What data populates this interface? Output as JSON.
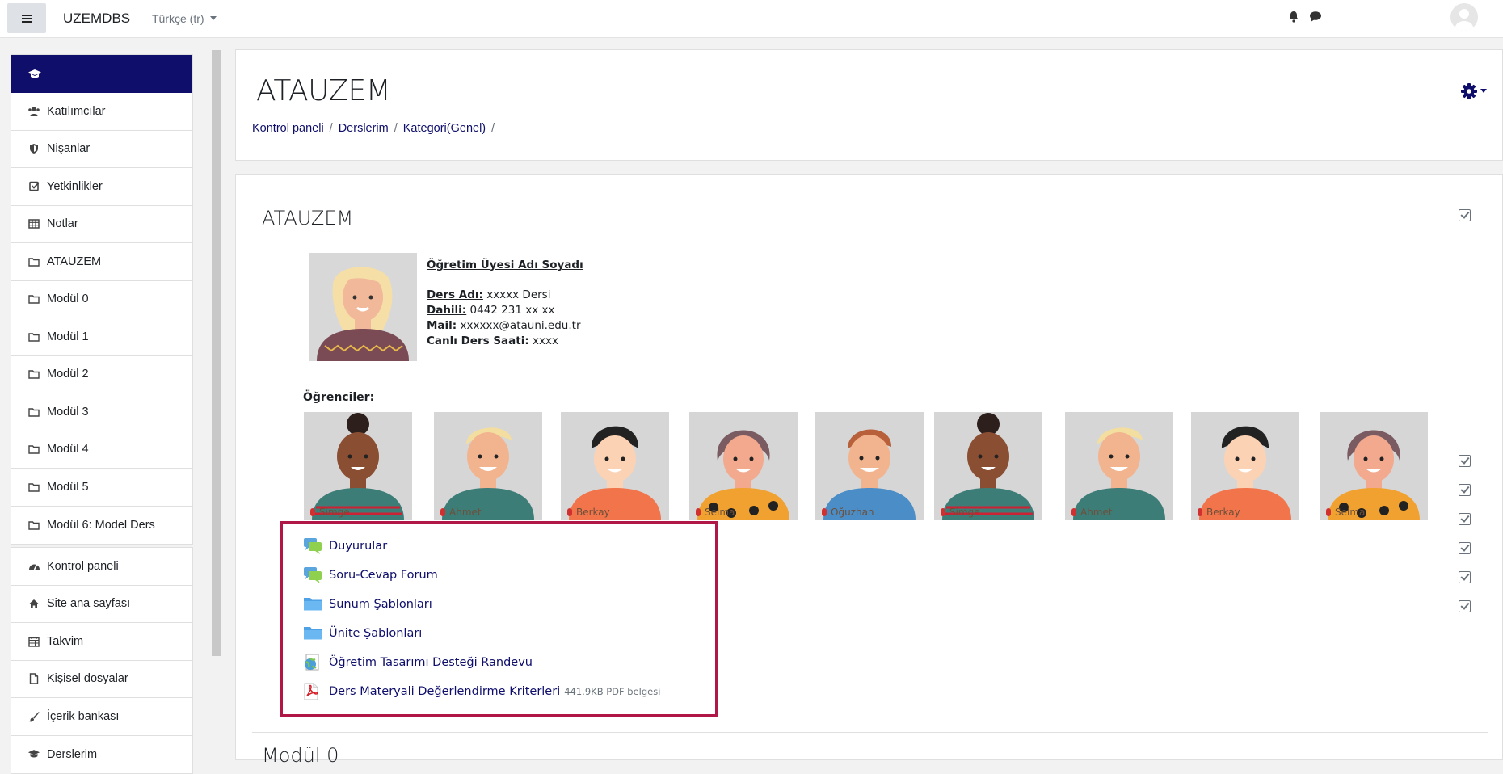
{
  "topbar": {
    "brand": "UZEMDBS",
    "language": "Türkçe (tr)",
    "icons": [
      "menu-icon",
      "bell-icon",
      "chat-icon",
      "user-avatar"
    ]
  },
  "sidebar": {
    "header_icon": "graduation-cap-icon",
    "items": [
      {
        "label": "Katılımcılar",
        "icon": "users-icon"
      },
      {
        "label": "Nişanlar",
        "icon": "shield-icon"
      },
      {
        "label": "Yetkinlikler",
        "icon": "check-square-icon"
      },
      {
        "label": "Notlar",
        "icon": "table-icon"
      },
      {
        "label": "ATAUZEM",
        "icon": "folder-icon"
      },
      {
        "label": "Modül 0",
        "icon": "folder-icon"
      },
      {
        "label": "Modül 1",
        "icon": "folder-icon"
      },
      {
        "label": "Modül 2",
        "icon": "folder-icon"
      },
      {
        "label": "Modül 3",
        "icon": "folder-icon"
      },
      {
        "label": "Modül 4",
        "icon": "folder-icon"
      },
      {
        "label": "Modül 5",
        "icon": "folder-icon"
      },
      {
        "label": "Modül 6: Model Ders",
        "icon": "folder-icon"
      }
    ],
    "items2": [
      {
        "label": "Kontrol paneli",
        "icon": "dashboard-icon"
      },
      {
        "label": "Site ana sayfası",
        "icon": "home-icon"
      },
      {
        "label": "Takvim",
        "icon": "calendar-icon"
      },
      {
        "label": "Kişisel dosyalar",
        "icon": "file-icon"
      },
      {
        "label": "İçerik bankası",
        "icon": "paintbrush-icon"
      },
      {
        "label": "Derslerim",
        "icon": "graduation-cap-icon"
      }
    ]
  },
  "header": {
    "title": "ATAUZEM",
    "breadcrumb": [
      "Kontrol paneli",
      "Derslerim",
      "Kategori(Genel)"
    ]
  },
  "section": {
    "title": "ATAUZEM",
    "teacher": {
      "name_label": "Öğretim Üyesi Adı Soyadı",
      "course_label": "Ders Adı:",
      "course_value": " xxxxx Dersi",
      "ext_label": "Dahili:",
      "ext_value": " 0442 231 xx xx",
      "mail_label": "Mail:",
      "mail_value": " xxxxxx@atauni.edu.tr",
      "live_label": "Canlı Ders Saati:",
      "live_value": " xxxx"
    },
    "students_label": "Öğrenciler:",
    "students": [
      "Simge",
      "Ahmet",
      "Berkay",
      "Selma",
      "Oğuzhan",
      "Simge",
      "Ahmet",
      "Berkay",
      "Selma"
    ],
    "activities": [
      {
        "label": "Duyurular",
        "icon": "forum-icon",
        "meta": ""
      },
      {
        "label": "Soru-Cevap Forum",
        "icon": "forum-icon",
        "meta": ""
      },
      {
        "label": "Sunum Şablonları",
        "icon": "folder-icon",
        "meta": ""
      },
      {
        "label": "Ünite Şablonları",
        "icon": "folder-icon",
        "meta": ""
      },
      {
        "label": "Öğretim Tasarımı Desteği Randevu",
        "icon": "url-icon",
        "meta": ""
      },
      {
        "label": "Ders Materyali Değerlendirme Kriterleri",
        "icon": "pdf-icon",
        "meta": "441.9KB PDF belgesi"
      }
    ]
  },
  "next_section": {
    "title": "Modül 0"
  }
}
